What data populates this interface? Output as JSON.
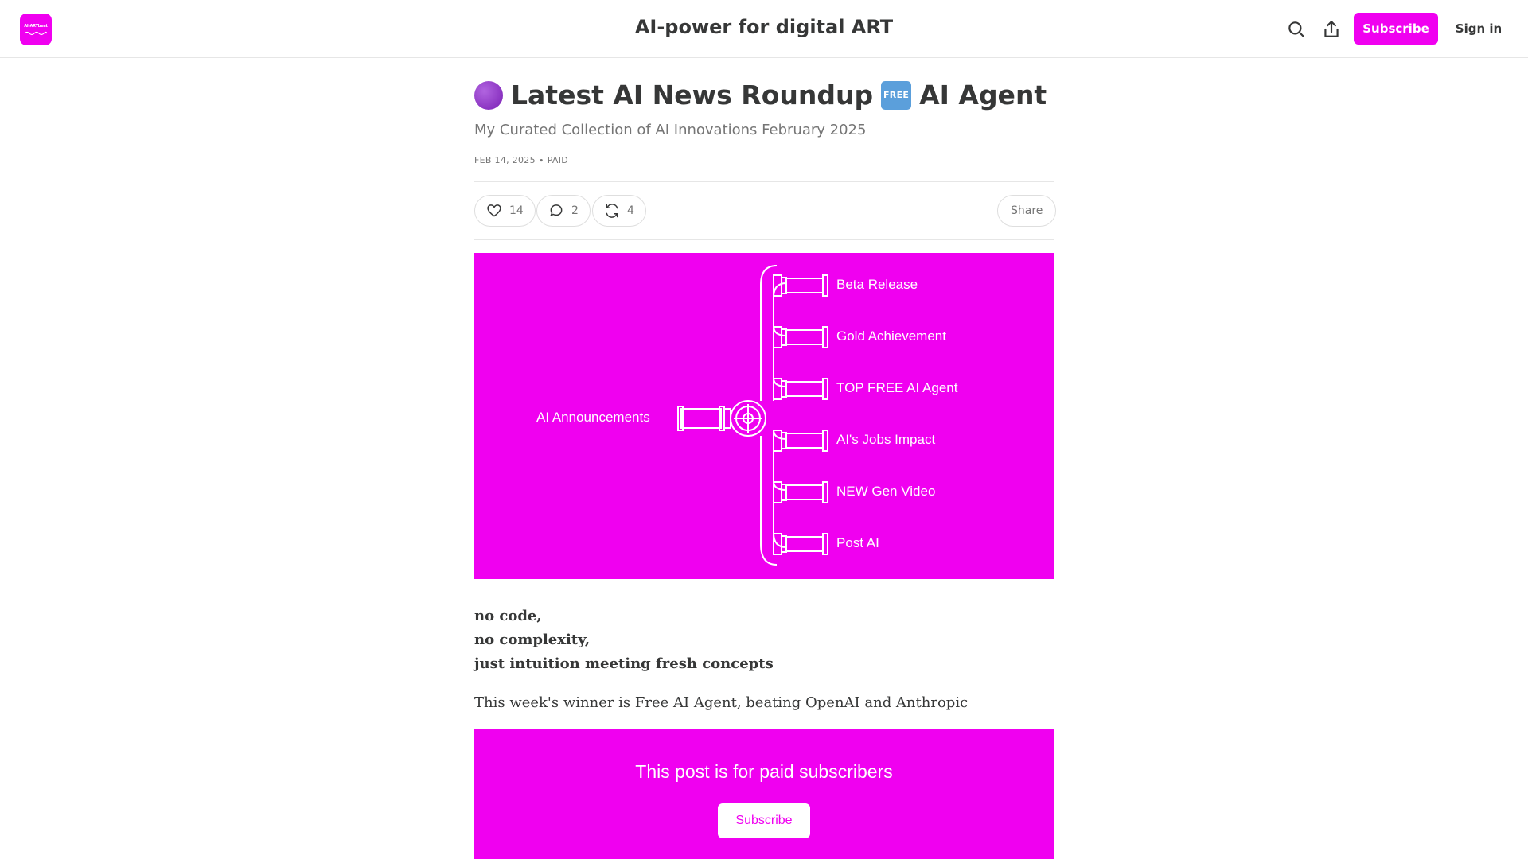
{
  "header": {
    "site_title": "AI-power for digital ART",
    "logo_text": "AI-ARTbeat",
    "subscribe_label": "Subscribe",
    "signin_label": "Sign in",
    "icons": [
      "search-icon",
      "share-icon"
    ]
  },
  "post": {
    "title_emoji": "purple-circle",
    "title_part1": "Latest AI News Roundup",
    "title_badge": "FREE",
    "title_part2": "AI Agent",
    "subtitle": "My Curated Collection of AI Innovations February 2025",
    "date": "FEB 14, 2025",
    "separator": "∙",
    "access": "PAID",
    "actions": {
      "likes": "14",
      "comments": "2",
      "restacks": "4",
      "share_label": "Share"
    }
  },
  "hero": {
    "source_label": "AI  Announcements",
    "branches": [
      "Beta Release",
      "Gold Achievement",
      "TOP FREE AI Agent",
      "AI's Jobs Impact",
      "NEW Gen Video",
      "Post AI"
    ],
    "background_color": "#f000f0"
  },
  "body": {
    "lines_bold": [
      "no code,",
      "no complexity,",
      "just intuition meeting fresh concepts"
    ],
    "paragraph": "This week's winner is Free AI Agent, beating OpenAI and Anthropic"
  },
  "paywall": {
    "title": "This post is for paid subscribers",
    "button_label": "Subscribe"
  },
  "colors": {
    "accent": "#f000f0",
    "text": "#363737",
    "muted": "#757575"
  }
}
